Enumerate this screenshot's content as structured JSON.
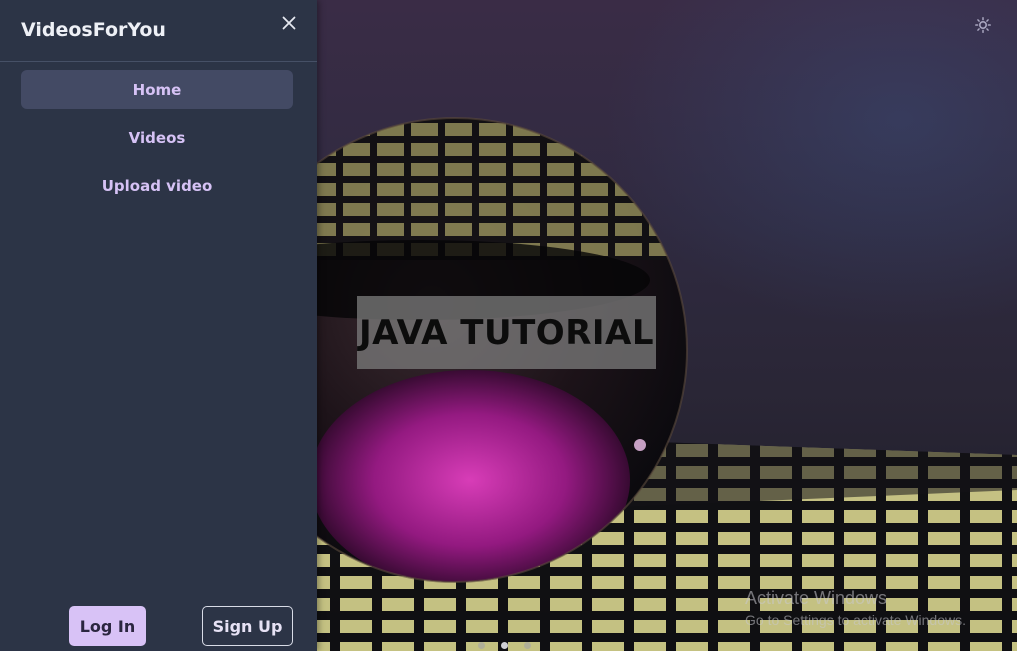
{
  "app": {
    "brand": "VideosForYou",
    "accent_color": "#d8c2f6",
    "sidebar_color": "#2c3446"
  },
  "sidebar": {
    "close_icon": "close-icon",
    "items": [
      {
        "label": "Home",
        "active": true
      },
      {
        "label": "Videos",
        "active": false
      },
      {
        "label": "Upload video",
        "active": false
      }
    ],
    "login_label": "Log In",
    "signup_label": "Sign Up"
  },
  "hero": {
    "title": "JAVA TUTORIAL",
    "carousel_total": 3,
    "carousel_active": 2
  },
  "header": {
    "theme_icon": "sun-icon"
  },
  "watermark": {
    "line1": "Activate Windows",
    "line2": "Go to Settings to activate Windows."
  }
}
